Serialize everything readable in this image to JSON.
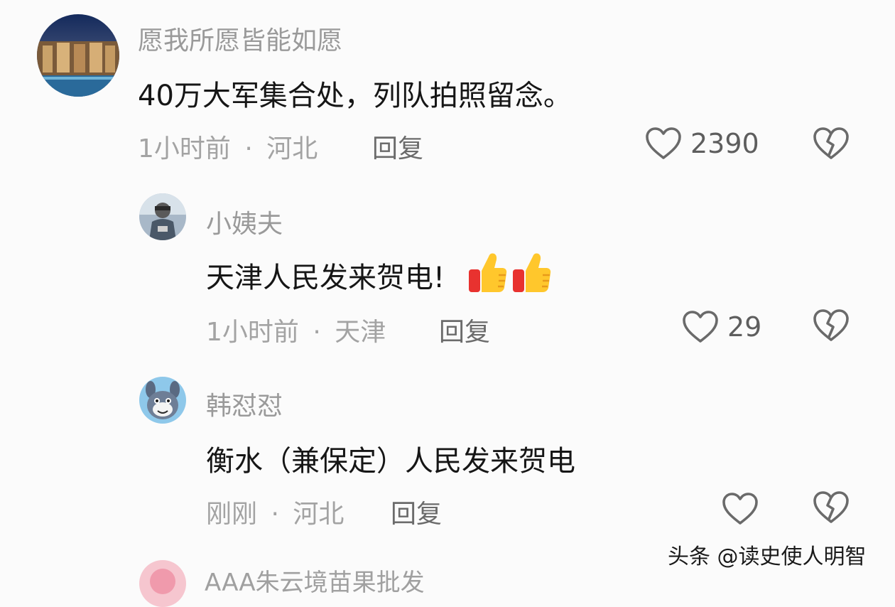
{
  "comments": [
    {
      "username": "愿我所愿皆能如愿",
      "text": "40万大军集合处，列队拍照留念。",
      "time": "1小时前",
      "location": "河北",
      "reply_label": "回复",
      "likes": "2390"
    },
    {
      "username": "小姨夫",
      "text": "天津人民发来贺电!",
      "time": "1小时前",
      "location": "天津",
      "reply_label": "回复",
      "likes": "29"
    },
    {
      "username": "韩怼怼",
      "text": "衡水（兼保定）人民发来贺电",
      "time": "刚刚",
      "location": "河北",
      "reply_label": "回复",
      "likes": ""
    }
  ],
  "partial_next_username": "AAA朱云境苗果批发",
  "meta_separator": "·",
  "watermark": "头条 @读史使人明智",
  "icons": {
    "like": "heart-outline-icon",
    "dislike": "broken-heart-icon",
    "emoji": "thumbs-up-emoji"
  },
  "colors": {
    "background": "#fbfbfb",
    "username": "#9a9a9a",
    "text": "#161616",
    "meta": "#a3a3a3"
  }
}
